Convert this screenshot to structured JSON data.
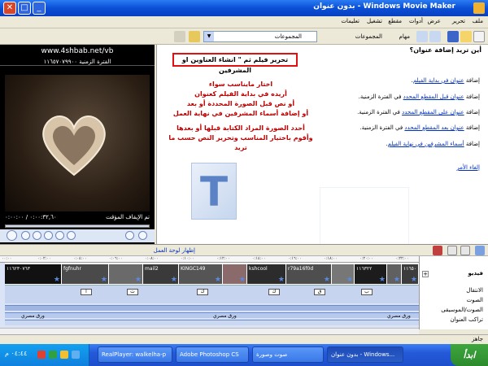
{
  "window": {
    "title": "بدون عنوان - Windows Movie Maker"
  },
  "menu": [
    "ملف",
    "تحرير",
    "عرض",
    "أدوات",
    "مقطع",
    "تشغيل",
    "تعليمات"
  ],
  "toolbar": {
    "tasks_label": "مهام",
    "collections_label": "المجموعات",
    "combo_value": "المجموعات"
  },
  "preview": {
    "url": "www.4shbab.net/vb",
    "time_header": "الفترة الزمنية ١١٦٥٧٠٧٩٩٠٠",
    "status": "تم الإيقاف المؤقت",
    "time": "٠:٠٠:٣٢,٦٠ / ٠:٠٠:٠٠"
  },
  "task": {
    "title": "أين تريد إضافة عنوان؟",
    "redbox": "تحرير فيلم ثم \" انشاء العناوين او المشرفين",
    "annotations": [
      "اختار مايناسب سواء",
      "أريده في بداية الفيلم كعنوان",
      "أو نص قبل الصورة المحددة أو بعد",
      "أو إضافة أسماء المشرفين في نهاية العمل",
      "أحدد الصورة المراد الكتابة قبلها أو بعدها",
      "وأقوم باختيار المناسب وتحرير النص حسب ما تريد"
    ],
    "lines": [
      {
        "pre": "إضافة ",
        "link": "عنوان في بداية الفيلم",
        "post": "."
      },
      {
        "pre": "إضافة ",
        "link": "عنوان قبل المقطع المحدد",
        "post": " في الفترة الزمنية."
      },
      {
        "pre": "إضافة ",
        "link": "عنوان على المقطع المحدد",
        "post": " في الفترة الزمنية."
      },
      {
        "pre": "إضافة ",
        "link": "عنوان بعد المقطع المحدد",
        "post": " في الفترة الزمنية."
      },
      {
        "pre": "إضافة ",
        "link": "أسماء المشرفين في نهاية الفيلم",
        "post": "."
      }
    ],
    "cancel": "إلغاء الأمر"
  },
  "timeline": {
    "show_storyboard": "إظهار لوحة العمل",
    "ruler": [
      "٠٠:٠٠",
      "٠:٠٢:٠٠",
      "٠:٠٤:٠٠",
      "٠:٠٦:٠٠",
      "٠:٠٨:٠٠",
      "٠:١٠:٠٠",
      "٠:١٢:٠٠",
      "٠:١٤:٠٠",
      "٠:١٦:٠٠",
      "٠:١٨:٠٠",
      "٠:٢٠:٠٠",
      "٠:٢٢:٠٠"
    ],
    "clips": [
      "١١٦٢٣٠٧٦٣",
      "fgfnuhr",
      "",
      "mail2",
      "KINGC149",
      "",
      "kshcool",
      "r79a16f0d",
      "",
      "١١٦٣٢٢",
      "",
      "١١٦٥٠"
    ],
    "transitions": [
      "ب",
      "ت",
      "ف",
      "ك",
      "ن",
      "ق",
      "ا"
    ],
    "audio_label": "ورق مصري",
    "labels": {
      "video": "فيديو",
      "transition": "الانتقال",
      "audio": "الصوت",
      "music": "الصوت/الموسيقى",
      "title_overlay": "تراكب العنوان"
    }
  },
  "status": "جاهز",
  "taskbar": {
    "start": "ابدأ",
    "clock": "٠٤:٤٤ م",
    "items": [
      "بدون عنوان - Windows...",
      "صوت وصورة",
      "Adobe Photoshop CS",
      "RealPlayer: walkelha-p"
    ]
  }
}
